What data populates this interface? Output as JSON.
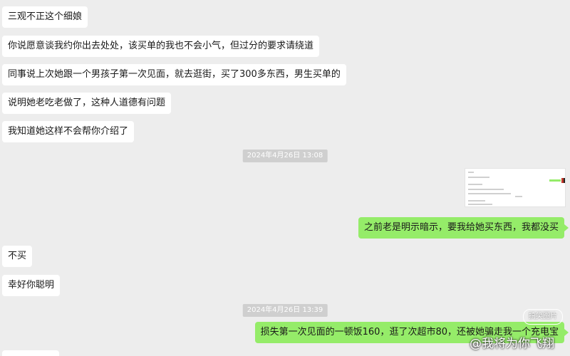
{
  "messages": [
    {
      "dir": "in",
      "text": "三观不正这个细娘"
    },
    {
      "dir": "in",
      "text": "你说愿意谈我约你出去处处，该买单的我也不会小气，但过分的要求请绕道"
    },
    {
      "dir": "in",
      "text": "同事说上次她跟一个男孩子第一次见面，就去逛街，买了300多东西，男生买单的"
    },
    {
      "dir": "in",
      "text": "说明她老吃老做了，这种人道德有问题"
    },
    {
      "dir": "in",
      "text": "我知道她这样不会帮你介绍了"
    },
    {
      "dir": "time",
      "text": "2024年4月26日 13:08"
    },
    {
      "dir": "out",
      "text": "之前老是明示暗示，要我给她买东西，我都没买"
    },
    {
      "dir": "in",
      "text": "不买"
    },
    {
      "dir": "in",
      "text": "幸好你聪明"
    },
    {
      "dir": "time",
      "text": "2024年4月26日 13:39"
    },
    {
      "dir": "out",
      "text": "损失第一次见面的一顿饭160，逛了次超市80，还被她骗走我一个充电宝"
    }
  ],
  "watermark": {
    "text": "@我将为你飞翔",
    "badge": "搞笑图片"
  }
}
